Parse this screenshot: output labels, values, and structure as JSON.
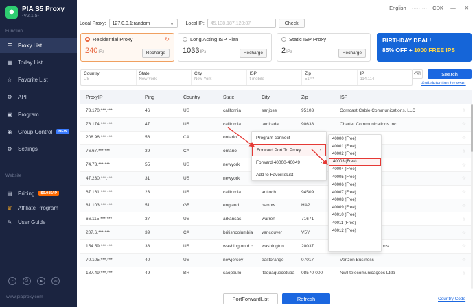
{
  "app": {
    "name": "PIA S5 Proxy",
    "version": "-V2.1.5-",
    "site": "www.piaproxy.com"
  },
  "topbar": {
    "language": "English",
    "user": "·········",
    "cdk": "CDK",
    "minimize": "—",
    "close": "✕"
  },
  "sidebar": {
    "function_label": "Function",
    "website_label": "Website",
    "items": [
      {
        "label": "Proxy List"
      },
      {
        "label": "Today List"
      },
      {
        "label": "Favorite List"
      },
      {
        "label": "API"
      },
      {
        "label": "Program"
      },
      {
        "label": "Group Control",
        "badge": "NEW"
      },
      {
        "label": "Settings"
      }
    ],
    "web_items": [
      {
        "label": "Pricing",
        "badge": "$0.045/IP"
      },
      {
        "label": "Affiliate Program"
      },
      {
        "label": "User Guide"
      }
    ]
  },
  "proxybar": {
    "local_proxy_label": "Local Proxy:",
    "local_proxy_value": "127.0.0.1:random",
    "local_ip_label": "Local IP:",
    "local_ip_value": "45.138.187.120:87",
    "check_label": "Check"
  },
  "cards": [
    {
      "title": "Residential Proxy",
      "count": "240",
      "unit": "IPs",
      "action": "Recharge"
    },
    {
      "title": "Long Acting ISP Plan",
      "count": "1033",
      "unit": "IPs",
      "action": "Recharge"
    },
    {
      "title": "Static ISP Proxy",
      "count": "2",
      "unit": "IPs",
      "action": "Recharge"
    }
  ],
  "banner": {
    "line1": "BIRTHDAY DEAL!",
    "line2_a": "85% OFF + ",
    "line2_b": "1000 FREE IPS"
  },
  "filters": [
    {
      "label": "Country",
      "value": "US"
    },
    {
      "label": "State",
      "value": "New York"
    },
    {
      "label": "City",
      "value": "New York"
    },
    {
      "label": "ISP",
      "value": "t-mobile"
    },
    {
      "label": "Zip",
      "value": "51***"
    },
    {
      "label": "IP",
      "value": "114.114"
    }
  ],
  "search_label": "Search",
  "anti_detection_label": "Anti-detection browser",
  "table": {
    "headers": [
      "ProxyIP",
      "Ping",
      "Country",
      "State",
      "City",
      "Zip",
      "ISP"
    ],
    "rows": [
      [
        "73.170.***.***",
        "46",
        "US",
        "california",
        "sanjose",
        "95103",
        "Comcast Cable Communications, LLC"
      ],
      [
        "76.174.***.***",
        "47",
        "US",
        "california",
        "lamirada",
        "90638",
        "Charter Communications Inc"
      ],
      [
        "208.96.***.***",
        "56",
        "CA",
        "ontario",
        "",
        "",
        ""
      ],
      [
        "76.67.***.***",
        "39",
        "CA",
        "ontario",
        "",
        "",
        ""
      ],
      [
        "74.73.***.***",
        "55",
        "US",
        "newyork",
        "",
        "",
        "ations Inc"
      ],
      [
        "47.230.***.***",
        "31",
        "US",
        "newyork",
        "manhattanbeach",
        "",
        ""
      ],
      [
        "67.161.***.***",
        "23",
        "US",
        "california",
        "antioch",
        "94509",
        "ations, LLC"
      ],
      [
        "81.103.***.***",
        "51",
        "GB",
        "england",
        "harrow",
        "HA2",
        "d"
      ],
      [
        "66.115.***.***",
        "37",
        "US",
        "arkansas",
        "warren",
        "71671",
        ""
      ],
      [
        "207.6.***.***",
        "39",
        "CA",
        "britishcolumbia",
        "vancouver",
        "V5Y",
        "ations Inc."
      ],
      [
        "154.59.***.***",
        "38",
        "US",
        "washington.d.c.",
        "washington",
        "20037",
        "Cogent Communications"
      ],
      [
        "70.105.***.***",
        "40",
        "US",
        "newjersey",
        "eastorange",
        "07017",
        "Verizon Business"
      ],
      [
        "187.49.***.***",
        "49",
        "BR",
        "sãopaulo",
        "itaquaquecetuba",
        "08570-000",
        "Nwll telecomunicações Ltda"
      ]
    ]
  },
  "context_menu": [
    {
      "label": "Program connect"
    },
    {
      "label": "Forward Port To Proxy",
      "arrow": "›"
    },
    {
      "label": "Forward 40000-40049",
      "arrow": "›"
    },
    {
      "label": "Add to FavoriteList"
    }
  ],
  "port_menu": [
    "40000 (Free)",
    "40001 (Free)",
    "40002 (Free)",
    "40003 (Free)",
    "40004 (Free)",
    "40005 (Free)",
    "40006 (Free)",
    "40007 (Free)",
    "40008 (Free)",
    "40009 (Free)",
    "40010 (Free)",
    "40011 (Free)",
    "40012 (Free)"
  ],
  "footer": {
    "port_forward_list": "PortForwardList",
    "refresh": "Refresh",
    "country_code": "Country Code"
  },
  "colors": {
    "sidebar_bg": "#1b2440",
    "accent": "#1b67e0",
    "highlight": "#e53935",
    "residential": "#e8643c"
  }
}
